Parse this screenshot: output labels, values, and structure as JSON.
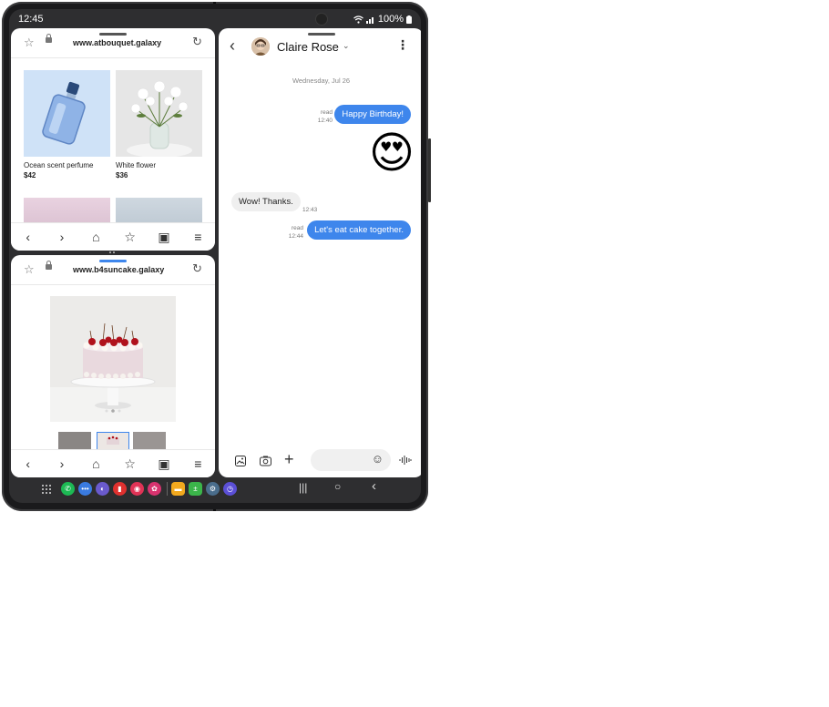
{
  "status": {
    "time": "12:45",
    "battery": "100%"
  },
  "browser_top": {
    "url": "www.atbouquet.galaxy",
    "products": [
      {
        "name": "Ocean scent perfume",
        "price": "$42"
      },
      {
        "name": "White flower",
        "price": "$36"
      }
    ]
  },
  "browser_bottom": {
    "url": "www.b4suncake.galaxy"
  },
  "chat": {
    "contact_name": "Claire Rose",
    "date": "Wednesday, Jul 26",
    "messages": [
      {
        "dir": "out",
        "status": "read",
        "time": "12:40",
        "text": "Happy Birthday!"
      },
      {
        "dir": "out",
        "emoji": "😍"
      },
      {
        "dir": "in",
        "time": "12:43",
        "text": "Wow! Thanks."
      },
      {
        "dir": "out",
        "status": "read",
        "time": "12:44",
        "text": "Let's eat cake together."
      }
    ]
  },
  "colors": {
    "accent": "#3e86ec"
  }
}
